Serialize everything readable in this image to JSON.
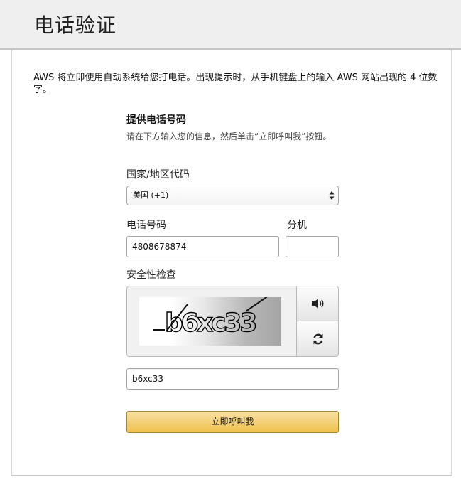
{
  "header": {
    "title": "电话验证"
  },
  "intro": {
    "text": "AWS 将立即使用自动系统给您打电话。出现提示时，从手机键盘上的输入 AWS 网站出现的 4 位数字。"
  },
  "form": {
    "section_title": "提供电话号码",
    "section_desc": "请在下方输入您的信息，然后单击“立即呼叫我”按钮。",
    "country": {
      "label": "国家/地区代码",
      "selected": "美国 (+1)"
    },
    "phone": {
      "label": "电话号码",
      "value": "4808678874"
    },
    "extension": {
      "label": "分机",
      "value": ""
    },
    "security": {
      "label": "安全性检查",
      "captcha_text": "b6xc33",
      "audio_icon": "speaker-icon",
      "refresh_icon": "refresh-icon",
      "input_value": "b6xc33"
    },
    "call_button": "立即呼叫我"
  },
  "colors": {
    "header_bg": "#efefef",
    "button_top": "#f7dfa5",
    "button_bottom": "#f0c14b",
    "button_border": "#a88734"
  }
}
